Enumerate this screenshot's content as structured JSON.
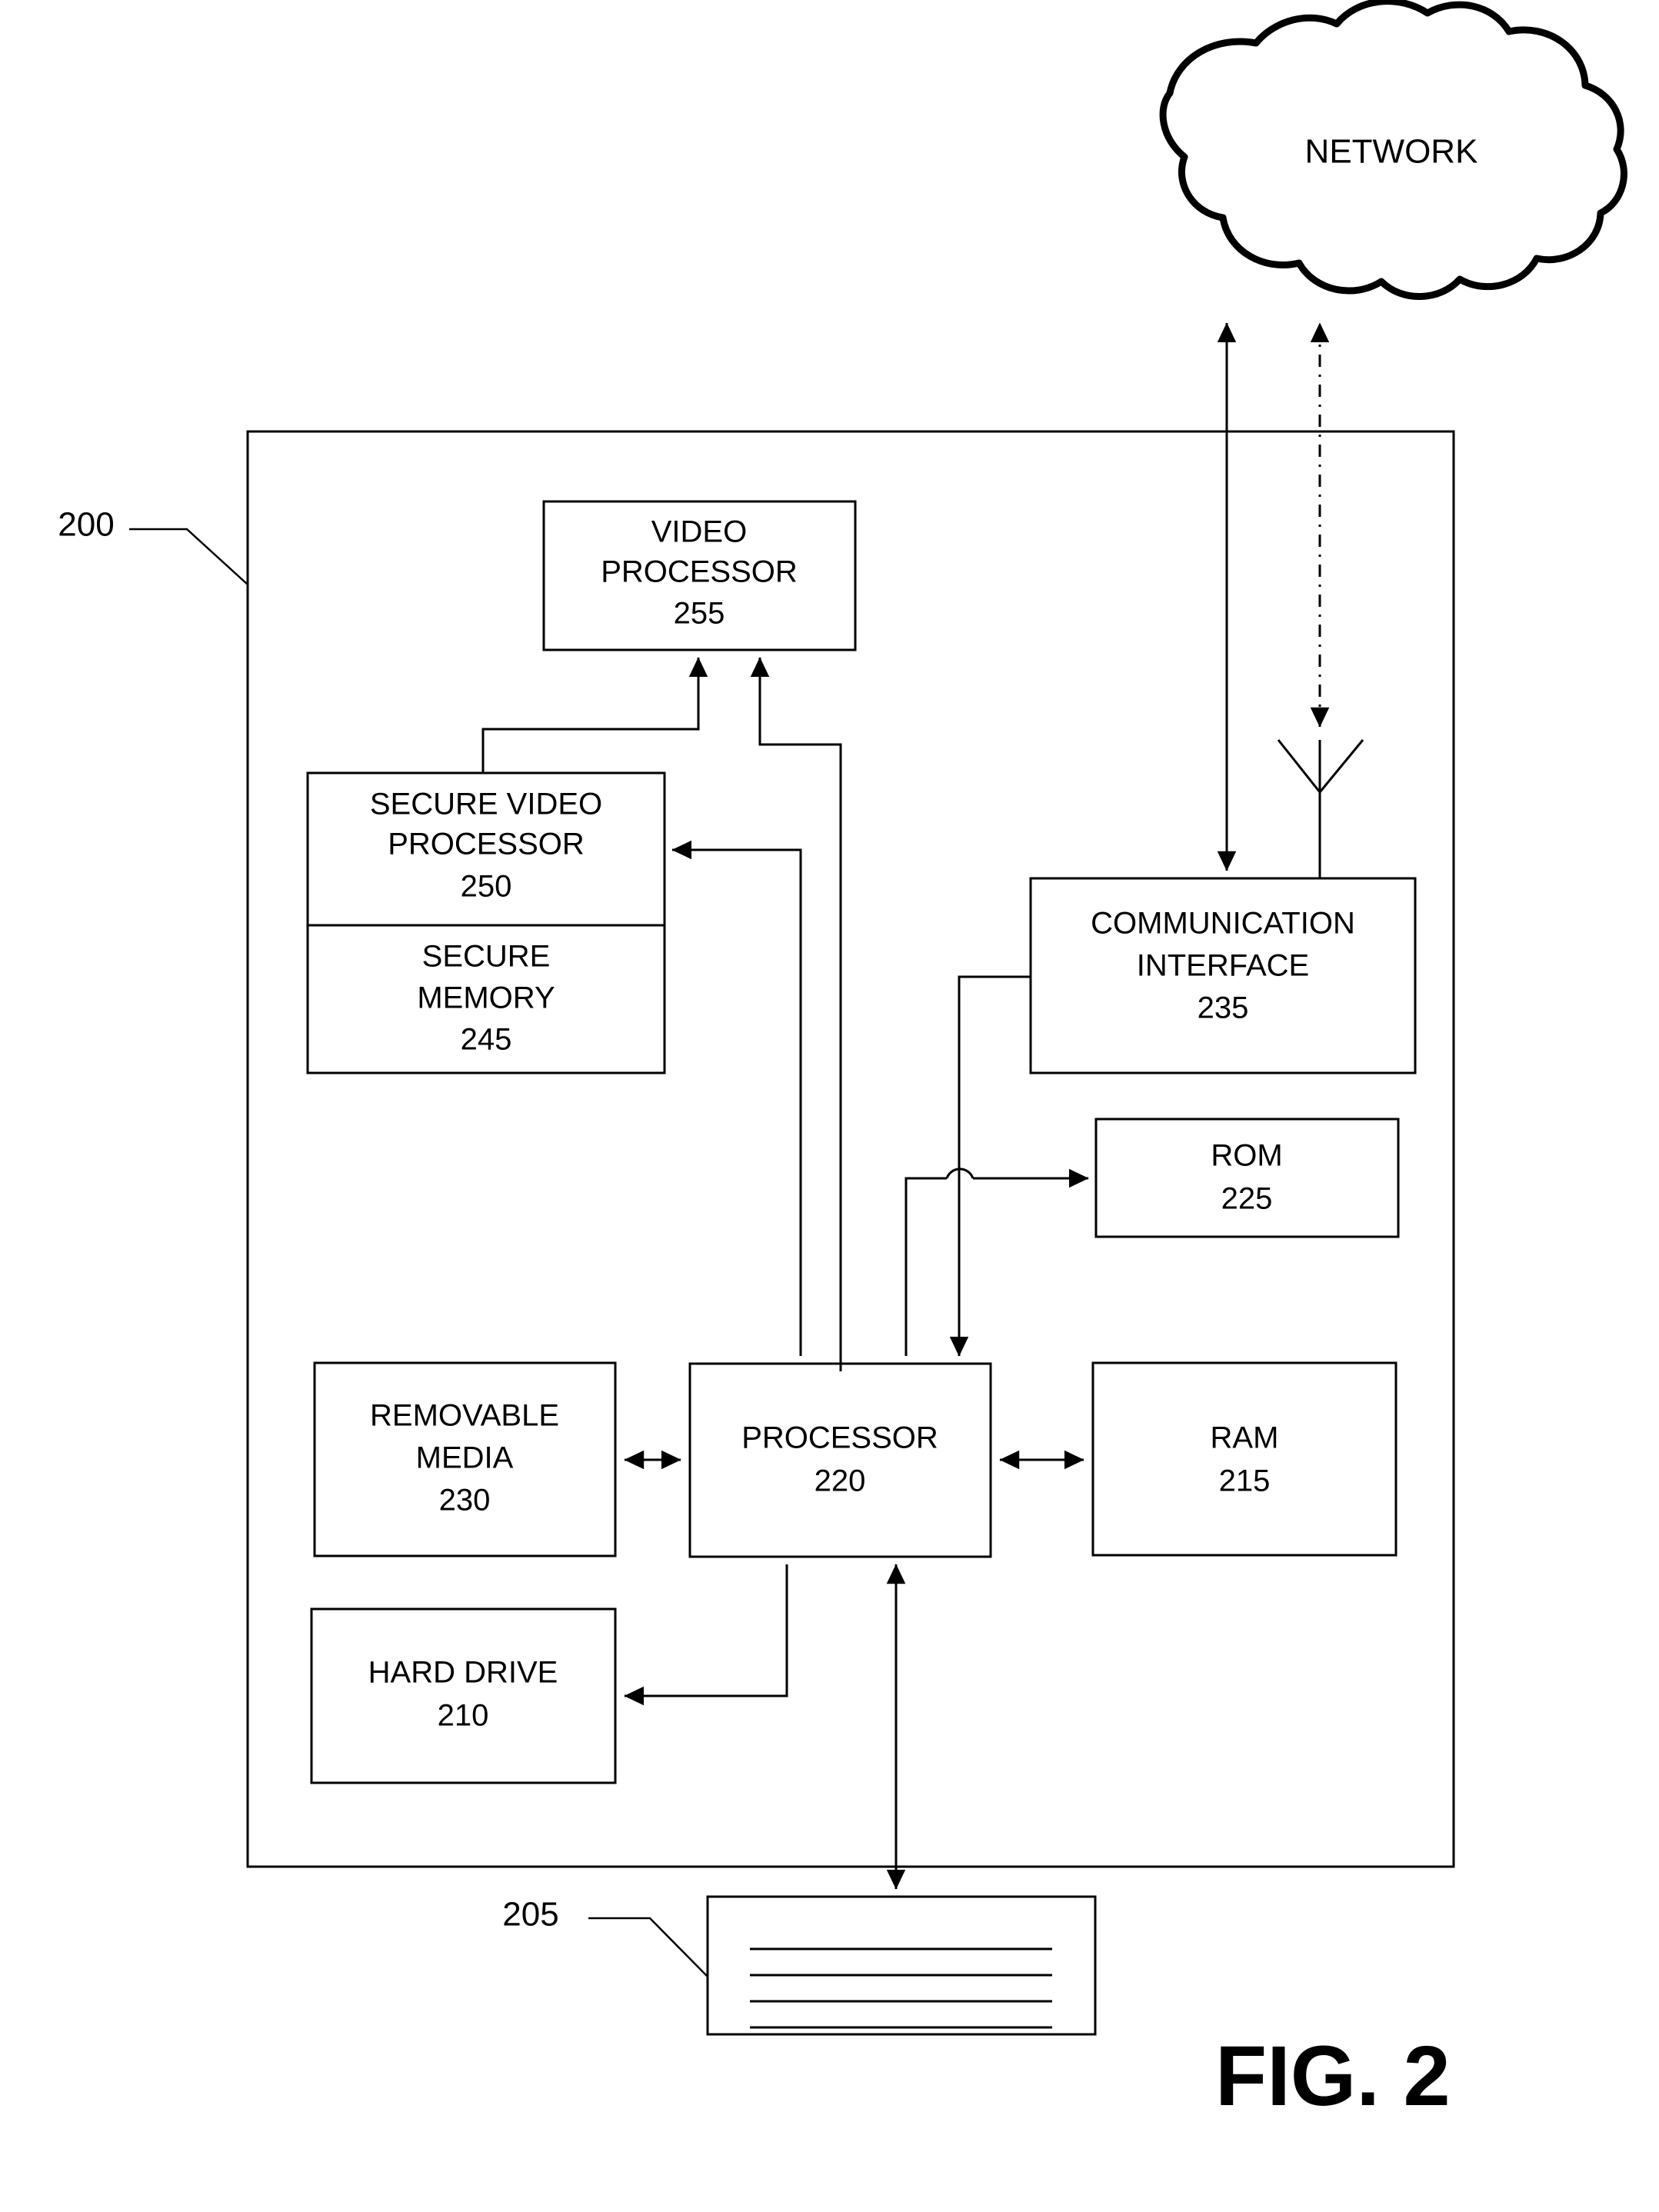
{
  "figure": {
    "caption": "FIG. 2",
    "reference_numerals": {
      "device": "200",
      "display": "205"
    }
  },
  "network": {
    "label": "NETWORK"
  },
  "blocks": {
    "video_processor": {
      "line1": "VIDEO",
      "line2": "PROCESSOR",
      "ref": "255"
    },
    "secure_video_processor": {
      "line1": "SECURE VIDEO",
      "line2": "PROCESSOR",
      "ref": "250"
    },
    "secure_memory": {
      "line1": "SECURE",
      "line2": "MEMORY",
      "ref": "245"
    },
    "communication_interface": {
      "line1": "COMMUNICATION",
      "line2": "INTERFACE",
      "ref": "235"
    },
    "rom": {
      "line1": "ROM",
      "ref": "225"
    },
    "ram": {
      "line1": "RAM",
      "ref": "215"
    },
    "processor": {
      "line1": "PROCESSOR",
      "ref": "220"
    },
    "removable_media": {
      "line1": "REMOVABLE",
      "line2": "MEDIA",
      "ref": "230"
    },
    "hard_drive": {
      "line1": "HARD DRIVE",
      "ref": "210"
    }
  },
  "colors": {
    "ink": "#000000",
    "paper": "#ffffff"
  }
}
